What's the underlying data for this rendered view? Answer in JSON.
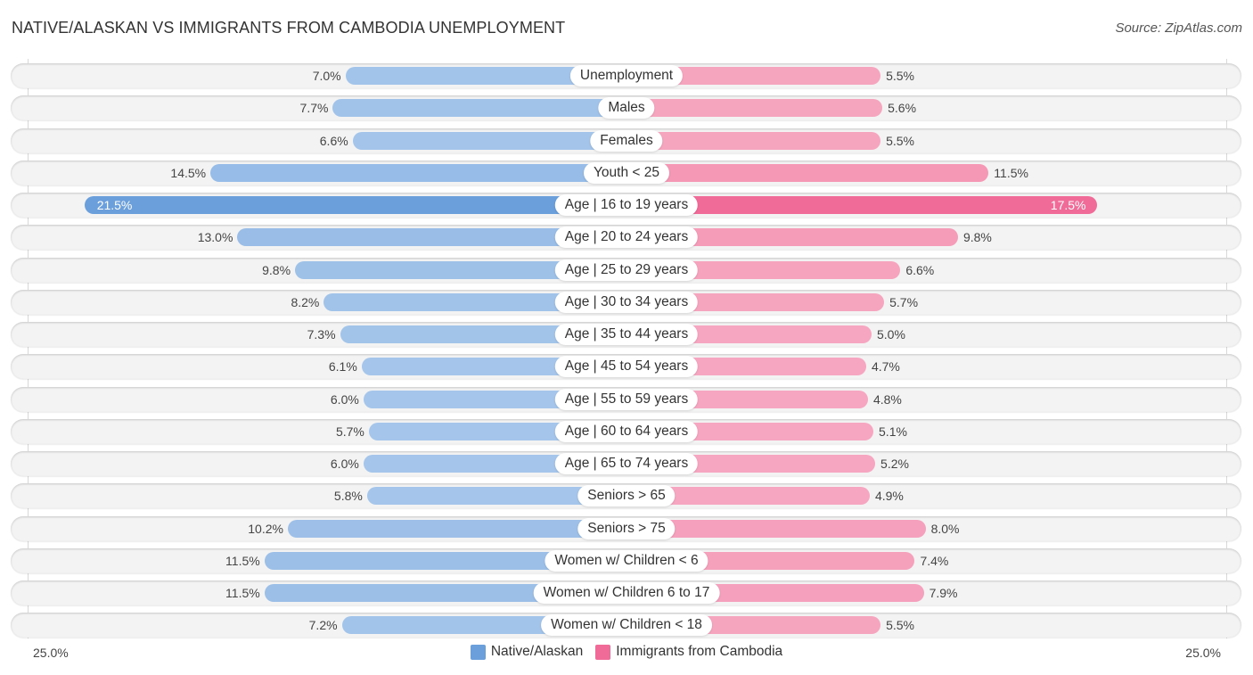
{
  "header": {
    "title": "NATIVE/ALASKAN VS IMMIGRANTS FROM CAMBODIA UNEMPLOYMENT",
    "source": "Source: ZipAtlas.com"
  },
  "colors": {
    "left_light": "#a5c5ea",
    "left_strong": "#6a9fdc",
    "right_light": "#f6a6c0",
    "right_strong": "#f06b97"
  },
  "chart_data": {
    "type": "bar",
    "orientation": "horizontal-diverging",
    "title": "NATIVE/ALASKAN VS IMMIGRANTS FROM CAMBODIA UNEMPLOYMENT",
    "xlim": [
      0,
      25.0
    ],
    "axis_labels": {
      "left": "25.0%",
      "right": "25.0%"
    },
    "legend_position": "bottom-center",
    "series": [
      {
        "name": "Native/Alaskan",
        "color": "#6a9fdc",
        "values": [
          7.0,
          7.7,
          6.6,
          14.5,
          21.5,
          13.0,
          9.8,
          8.2,
          7.3,
          6.1,
          6.0,
          5.7,
          6.0,
          5.8,
          10.2,
          11.5,
          11.5,
          7.2
        ]
      },
      {
        "name": "Immigrants from Cambodia",
        "color": "#f06b97",
        "values": [
          5.5,
          5.6,
          5.5,
          11.5,
          17.5,
          9.8,
          6.6,
          5.7,
          5.0,
          4.7,
          4.8,
          5.1,
          5.2,
          4.9,
          8.0,
          7.4,
          7.9,
          5.5
        ]
      }
    ],
    "categories": [
      "Unemployment",
      "Males",
      "Females",
      "Youth < 25",
      "Age | 16 to 19 years",
      "Age | 20 to 24 years",
      "Age | 25 to 29 years",
      "Age | 30 to 34 years",
      "Age | 35 to 44 years",
      "Age | 45 to 54 years",
      "Age | 55 to 59 years",
      "Age | 60 to 64 years",
      "Age | 65 to 74 years",
      "Seniors > 65",
      "Seniors > 75",
      "Women w/ Children < 6",
      "Women w/ Children 6 to 17",
      "Women w/ Children < 18"
    ],
    "left_labels": [
      "7.0%",
      "7.7%",
      "6.6%",
      "14.5%",
      "21.5%",
      "13.0%",
      "9.8%",
      "8.2%",
      "7.3%",
      "6.1%",
      "6.0%",
      "5.7%",
      "6.0%",
      "5.8%",
      "10.2%",
      "11.5%",
      "11.5%",
      "7.2%"
    ],
    "right_labels": [
      "5.5%",
      "5.6%",
      "5.5%",
      "11.5%",
      "17.5%",
      "9.8%",
      "6.6%",
      "5.7%",
      "5.0%",
      "4.7%",
      "4.8%",
      "5.1%",
      "5.2%",
      "4.9%",
      "8.0%",
      "7.4%",
      "7.9%",
      "5.5%"
    ],
    "highlight_index": 4
  },
  "legend": {
    "items": [
      {
        "label": "Native/Alaskan",
        "color": "#6a9fdc"
      },
      {
        "label": "Immigrants from Cambodia",
        "color": "#f06b97"
      }
    ]
  }
}
